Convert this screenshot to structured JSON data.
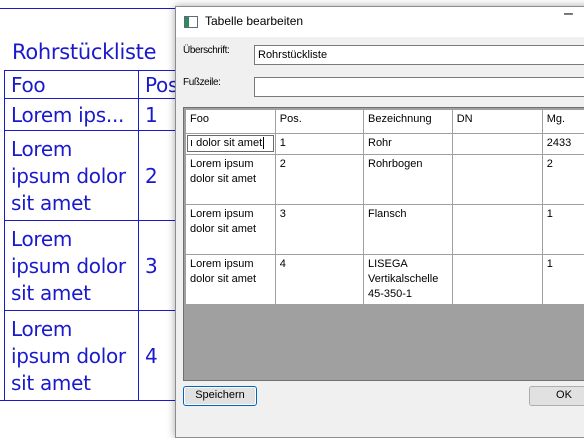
{
  "background": {
    "title": "Rohrstückliste",
    "header": [
      "Foo",
      "Pos"
    ],
    "rows": [
      {
        "foo": [
          "Lorem ips..."
        ],
        "pos": "1"
      },
      {
        "foo": [
          "Lorem",
          "ipsum dolor",
          "sit amet"
        ],
        "pos": "2"
      },
      {
        "foo": [
          "Lorem",
          "ipsum dolor",
          "sit amet"
        ],
        "pos": "3"
      },
      {
        "foo": [
          "Lorem",
          "ipsum dolor",
          "sit amet"
        ],
        "pos": "4"
      }
    ]
  },
  "dialog": {
    "title": "Tabelle bearbeiten",
    "minimize_glyph": "–",
    "heading_label": "Überschrift:",
    "heading_value": "Rohrstückliste",
    "footer_label": "Fußzeile:",
    "footer_value": "",
    "grid": {
      "columns": [
        "Foo",
        "Pos.",
        "Bezeichnung",
        "DN",
        "Mg."
      ],
      "rows": [
        {
          "foo": "ı dolor sit amet",
          "pos": "1",
          "bezeichnung": "Rohr",
          "dn": "",
          "mg": "2433"
        },
        {
          "foo": "Lorem ipsum dolor sit amet",
          "pos": "2",
          "bezeichnung": "Rohrbogen",
          "dn": "",
          "mg": "2"
        },
        {
          "foo": "Lorem ipsum dolor sit amet",
          "pos": "3",
          "bezeichnung": "Flansch",
          "dn": "",
          "mg": "1"
        },
        {
          "foo": "Lorem ipsum dolor sit amet",
          "pos": "4",
          "bezeichnung": "LISEGA Vertikalschelle 45-350-1",
          "dn": "",
          "mg": "1"
        }
      ]
    },
    "save_label": "Speichern",
    "ok_label": "OK"
  }
}
